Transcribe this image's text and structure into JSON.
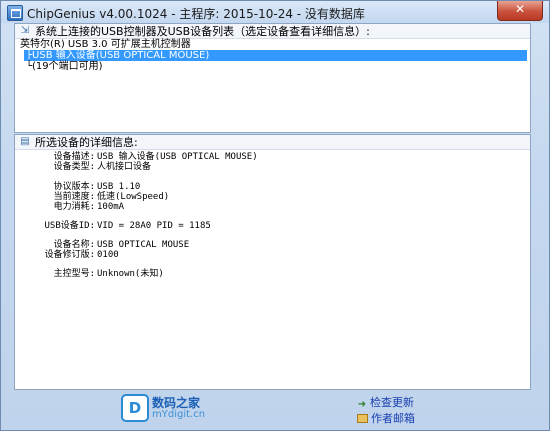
{
  "window": {
    "title": "ChipGenius v4.00.1024 - 主程序: 2015-10-24 - 没有数据库",
    "close_glyph": "✕"
  },
  "device_list": {
    "header": "系统上连接的USB控制器及USB设备列表（选定设备查看详细信息）:",
    "items": [
      "英特尔(R) USB 3.0 可扩展主机控制器",
      "├USB 输入设备(USB OPTICAL MOUSE)",
      "└(19个端口可用)"
    ],
    "selected_index": 1
  },
  "details": {
    "header": "所选设备的详细信息:",
    "rows": [
      {
        "label": "设备描述:",
        "value": "USB 输入设备(USB OPTICAL MOUSE)"
      },
      {
        "label": "设备类型:",
        "value": "人机接口设备"
      },
      {
        "label": "协议版本:",
        "value": "USB 1.10"
      },
      {
        "label": "当前速度:",
        "value": "低速(LowSpeed)"
      },
      {
        "label": "电力消耗:",
        "value": "100mA"
      },
      {
        "label": "USB设备ID:",
        "value": "VID = 28A0 PID = 1185"
      },
      {
        "label": "设备名称:",
        "value": "USB OPTICAL MOUSE"
      },
      {
        "label": "设备修订版:",
        "value": "0100"
      },
      {
        "label": "主控型号:",
        "value": "Unknown(未知)"
      }
    ]
  },
  "footer": {
    "logo_glyph": "D",
    "logo_name": "数码之家",
    "logo_url": "mYdigit.cn",
    "check_update": "检查更新",
    "author_email": "作者邮箱"
  },
  "icons": {
    "list_header_icon": "tree-icon",
    "details_header_icon": "document-icon"
  }
}
